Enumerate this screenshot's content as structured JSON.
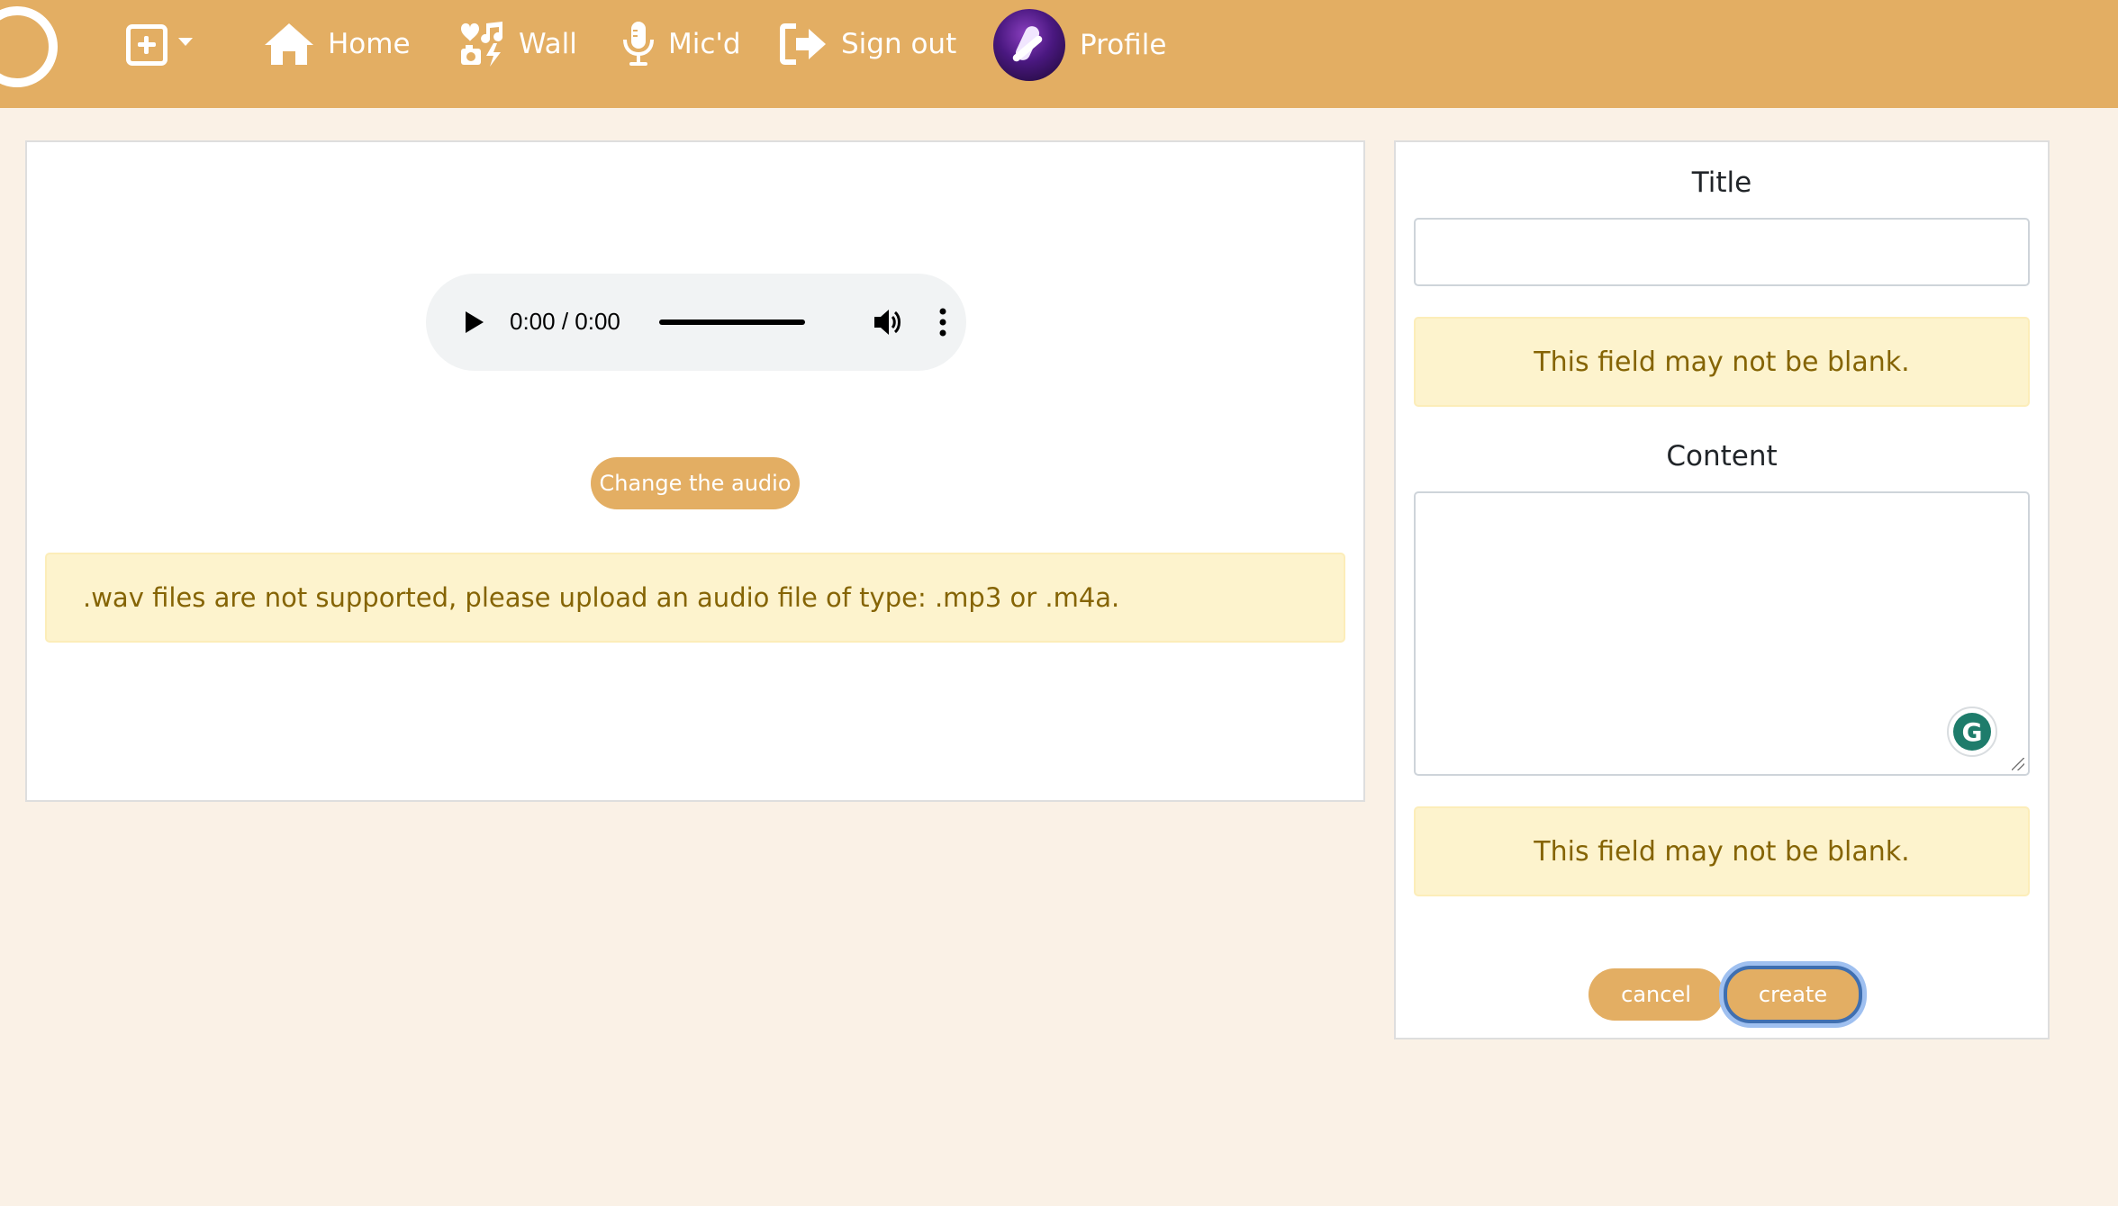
{
  "navbar": {
    "home_label": "Home",
    "wall_label": "Wall",
    "micd_label": "Mic'd",
    "signout_label": "Sign out",
    "profile_label": "Profile",
    "background_color": "#e3ae63"
  },
  "left_panel": {
    "audio_player": {
      "time_display": "0:00 / 0:00",
      "play_icon": "play-icon",
      "volume_icon": "volume-icon",
      "more_icon": "more-vertical-icon"
    },
    "change_audio_label": "Change the audio",
    "error_message": ".wav files are not supported, please upload an audio file of type: .mp3 or .m4a."
  },
  "right_panel": {
    "title_label": "Title",
    "title_value": "",
    "title_error": "This field may not be blank.",
    "content_label": "Content",
    "content_value": "",
    "content_error": "This field may not be blank.",
    "cancel_label": "cancel",
    "create_label": "create",
    "grammarly_letter": "G"
  },
  "colors": {
    "accent": "#e3ae63",
    "page_background": "#faf1e6",
    "warning_background": "#fdf3cd",
    "warning_text": "#856404"
  }
}
